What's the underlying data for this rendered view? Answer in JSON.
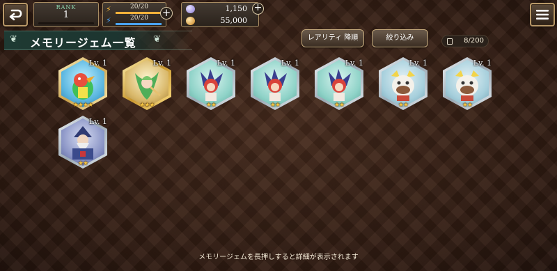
{
  "header": {
    "rank_label": "RANK",
    "rank_value": "1",
    "stamina": [
      {
        "value": "20/20",
        "color": "#f2b23a"
      },
      {
        "value": "20/20",
        "color": "#4aa3ff"
      }
    ],
    "currencies": [
      {
        "icon": "quill-icon",
        "value": "1,150"
      },
      {
        "icon": "coin-icon",
        "value": "55,000"
      }
    ]
  },
  "page": {
    "title": "メモリージェム一覧",
    "sort_label": "レアリティ 降順",
    "filter_label": "絞り込み",
    "count": "8/200",
    "hint": "メモリージェムを長押しすると詳細が表示されます"
  },
  "gems": [
    {
      "level": "Lv. 1",
      "stars": "★★★★",
      "frame": "gold-ornate",
      "character": "colorful-bird-character-icon",
      "rarity": 4
    },
    {
      "level": "Lv. 1",
      "stars": "★★★",
      "frame": "gold",
      "character": "green-fairy-character-icon",
      "rarity": 3
    },
    {
      "level": "Lv. 1",
      "stars": "★★",
      "frame": "silver",
      "character": "red-hair-girl-character-icon",
      "rarity": 2
    },
    {
      "level": "Lv. 1",
      "stars": "★★",
      "frame": "silver",
      "character": "red-hair-girl-character-icon",
      "rarity": 2
    },
    {
      "level": "Lv. 1",
      "stars": "★★",
      "frame": "silver",
      "character": "red-hair-girl-character-icon",
      "rarity": 2
    },
    {
      "level": "Lv. 1",
      "stars": "★★",
      "frame": "silver",
      "character": "white-beast-character-icon",
      "rarity": 2
    },
    {
      "level": "Lv. 1",
      "stars": "★★",
      "frame": "silver",
      "character": "white-beast-character-icon",
      "rarity": 2
    },
    {
      "level": "Lv. 1",
      "stars": "★★",
      "frame": "silver",
      "character": "bearded-wizard-character-icon",
      "rarity": 2
    }
  ]
}
